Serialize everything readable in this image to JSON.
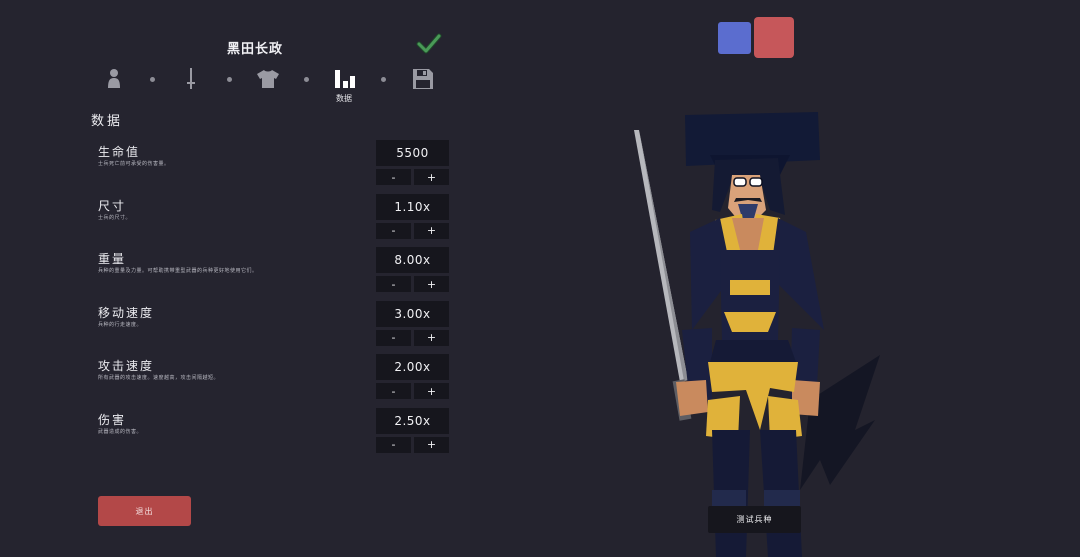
{
  "unit": {
    "name": "黑田长政"
  },
  "steps": [
    {
      "id": "appearance",
      "icon": "person-icon",
      "label": "",
      "active": false
    },
    {
      "id": "weapons",
      "icon": "sword-icon",
      "label": "",
      "active": false
    },
    {
      "id": "clothing",
      "icon": "shirt-icon",
      "label": "",
      "active": false
    },
    {
      "id": "data",
      "icon": "bar-chart-icon",
      "label": "数据",
      "active": true
    },
    {
      "id": "save",
      "icon": "floppy-disk-icon",
      "label": "",
      "active": false
    }
  ],
  "section": {
    "title": "数据"
  },
  "stats": [
    {
      "name": "生命值",
      "desc": "士兵死亡前可承受的伤害量。",
      "value": "5500",
      "minus": "-",
      "plus": "+"
    },
    {
      "name": "尺寸",
      "desc": "士兵的尺寸。",
      "value": "1.10x",
      "minus": "-",
      "plus": "+"
    },
    {
      "name": "重量",
      "desc": "兵种的重量及力量。可帮助携带重型武器的兵种更好地使用它们。",
      "value": "8.00x",
      "minus": "-",
      "plus": "+"
    },
    {
      "name": "移动速度",
      "desc": "兵种的行走速度。",
      "value": "3.00x",
      "minus": "-",
      "plus": "+"
    },
    {
      "name": "攻击速度",
      "desc": "所有武器的攻击速度。速度越高，攻击间隔越短。",
      "value": "2.00x",
      "minus": "-",
      "plus": "+"
    },
    {
      "name": "伤害",
      "desc": "武器造成的伤害。",
      "value": "2.50x",
      "minus": "-",
      "plus": "+"
    }
  ],
  "buttons": {
    "exit": "退出",
    "test": "测试兵种"
  },
  "colors": {
    "background": "#24232e",
    "team_blue": "#5b6dcf",
    "team_red": "#c6575a",
    "exit_button": "#b34848",
    "check": "#4a9a58",
    "armor_dark": "#1b2040",
    "armor_gold": "#e0b23a"
  }
}
